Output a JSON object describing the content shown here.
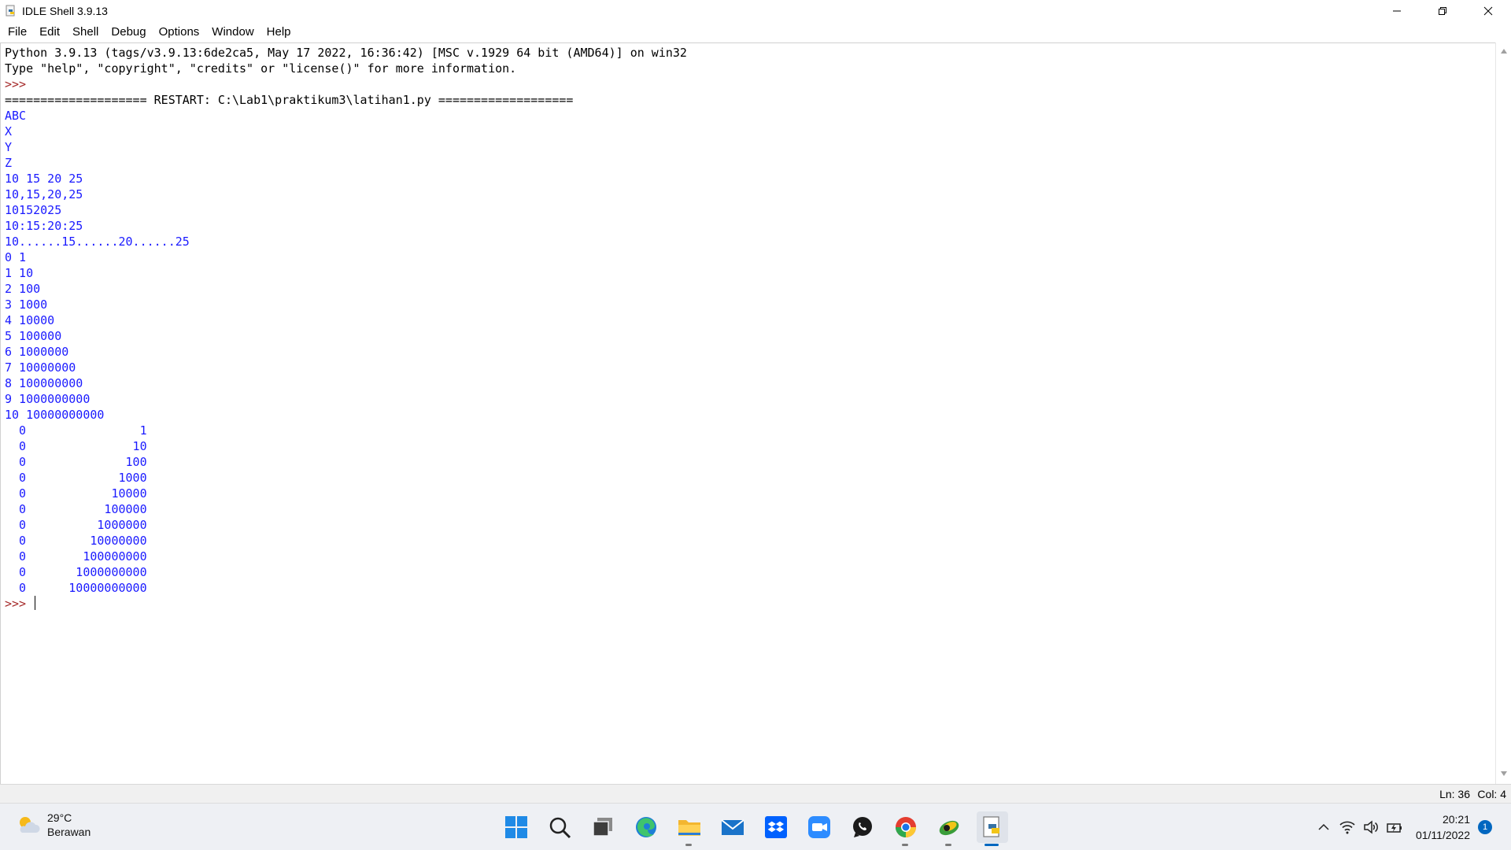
{
  "window": {
    "title": "IDLE Shell 3.9.13"
  },
  "menu": [
    "File",
    "Edit",
    "Shell",
    "Debug",
    "Options",
    "Window",
    "Help"
  ],
  "shell": {
    "lines": [
      {
        "text": "Python 3.9.13 (tags/v3.9.13:6de2ca5, May 17 2022, 16:36:42) [MSC v.1929 64 bit (AMD64)] on win32",
        "kind": "black"
      },
      {
        "text": "Type \"help\", \"copyright\", \"credits\" or \"license()\" for more information.",
        "kind": "black"
      },
      {
        "text": ">>> ",
        "kind": "prompt"
      },
      {
        "text": "==================== RESTART: C:\\Lab1\\praktikum3\\latihan1.py ===================",
        "kind": "black"
      },
      {
        "text": "ABC",
        "kind": "out"
      },
      {
        "text": "X",
        "kind": "out"
      },
      {
        "text": "Y",
        "kind": "out"
      },
      {
        "text": "Z",
        "kind": "out"
      },
      {
        "text": "10 15 20 25",
        "kind": "out"
      },
      {
        "text": "10,15,20,25",
        "kind": "out"
      },
      {
        "text": "10152025",
        "kind": "out"
      },
      {
        "text": "10:15:20:25",
        "kind": "out"
      },
      {
        "text": "10......15......20......25",
        "kind": "out"
      },
      {
        "text": "0 1",
        "kind": "out"
      },
      {
        "text": "1 10",
        "kind": "out"
      },
      {
        "text": "2 100",
        "kind": "out"
      },
      {
        "text": "3 1000",
        "kind": "out"
      },
      {
        "text": "4 10000",
        "kind": "out"
      },
      {
        "text": "5 100000",
        "kind": "out"
      },
      {
        "text": "6 1000000",
        "kind": "out"
      },
      {
        "text": "7 10000000",
        "kind": "out"
      },
      {
        "text": "8 100000000",
        "kind": "out"
      },
      {
        "text": "9 1000000000",
        "kind": "out"
      },
      {
        "text": "10 10000000000",
        "kind": "out"
      },
      {
        "text": "  0                1",
        "kind": "out"
      },
      {
        "text": "  0               10",
        "kind": "out"
      },
      {
        "text": "  0              100",
        "kind": "out"
      },
      {
        "text": "  0             1000",
        "kind": "out"
      },
      {
        "text": "  0            10000",
        "kind": "out"
      },
      {
        "text": "  0           100000",
        "kind": "out"
      },
      {
        "text": "  0          1000000",
        "kind": "out"
      },
      {
        "text": "  0         10000000",
        "kind": "out"
      },
      {
        "text": "  0        100000000",
        "kind": "out"
      },
      {
        "text": "  0       1000000000",
        "kind": "out"
      },
      {
        "text": "  0      10000000000",
        "kind": "out"
      },
      {
        "text": ">>> ",
        "kind": "prompt",
        "cursor": true
      }
    ]
  },
  "status": {
    "ln": "Ln: 36",
    "col": "Col: 4"
  },
  "taskbar": {
    "weather_temp": "29°C",
    "weather_desc": "Berawan",
    "apps": [
      "start-icon",
      "search-icon",
      "task-view-icon",
      "edge-icon",
      "file-explorer-icon",
      "mail-icon",
      "dropbox-icon",
      "zoom-icon",
      "whatsapp-icon",
      "chrome-icon",
      "app-icon",
      "python-idle-icon"
    ],
    "clock_time": "20:21",
    "clock_date": "01/11/2022",
    "notification_count": "1"
  }
}
